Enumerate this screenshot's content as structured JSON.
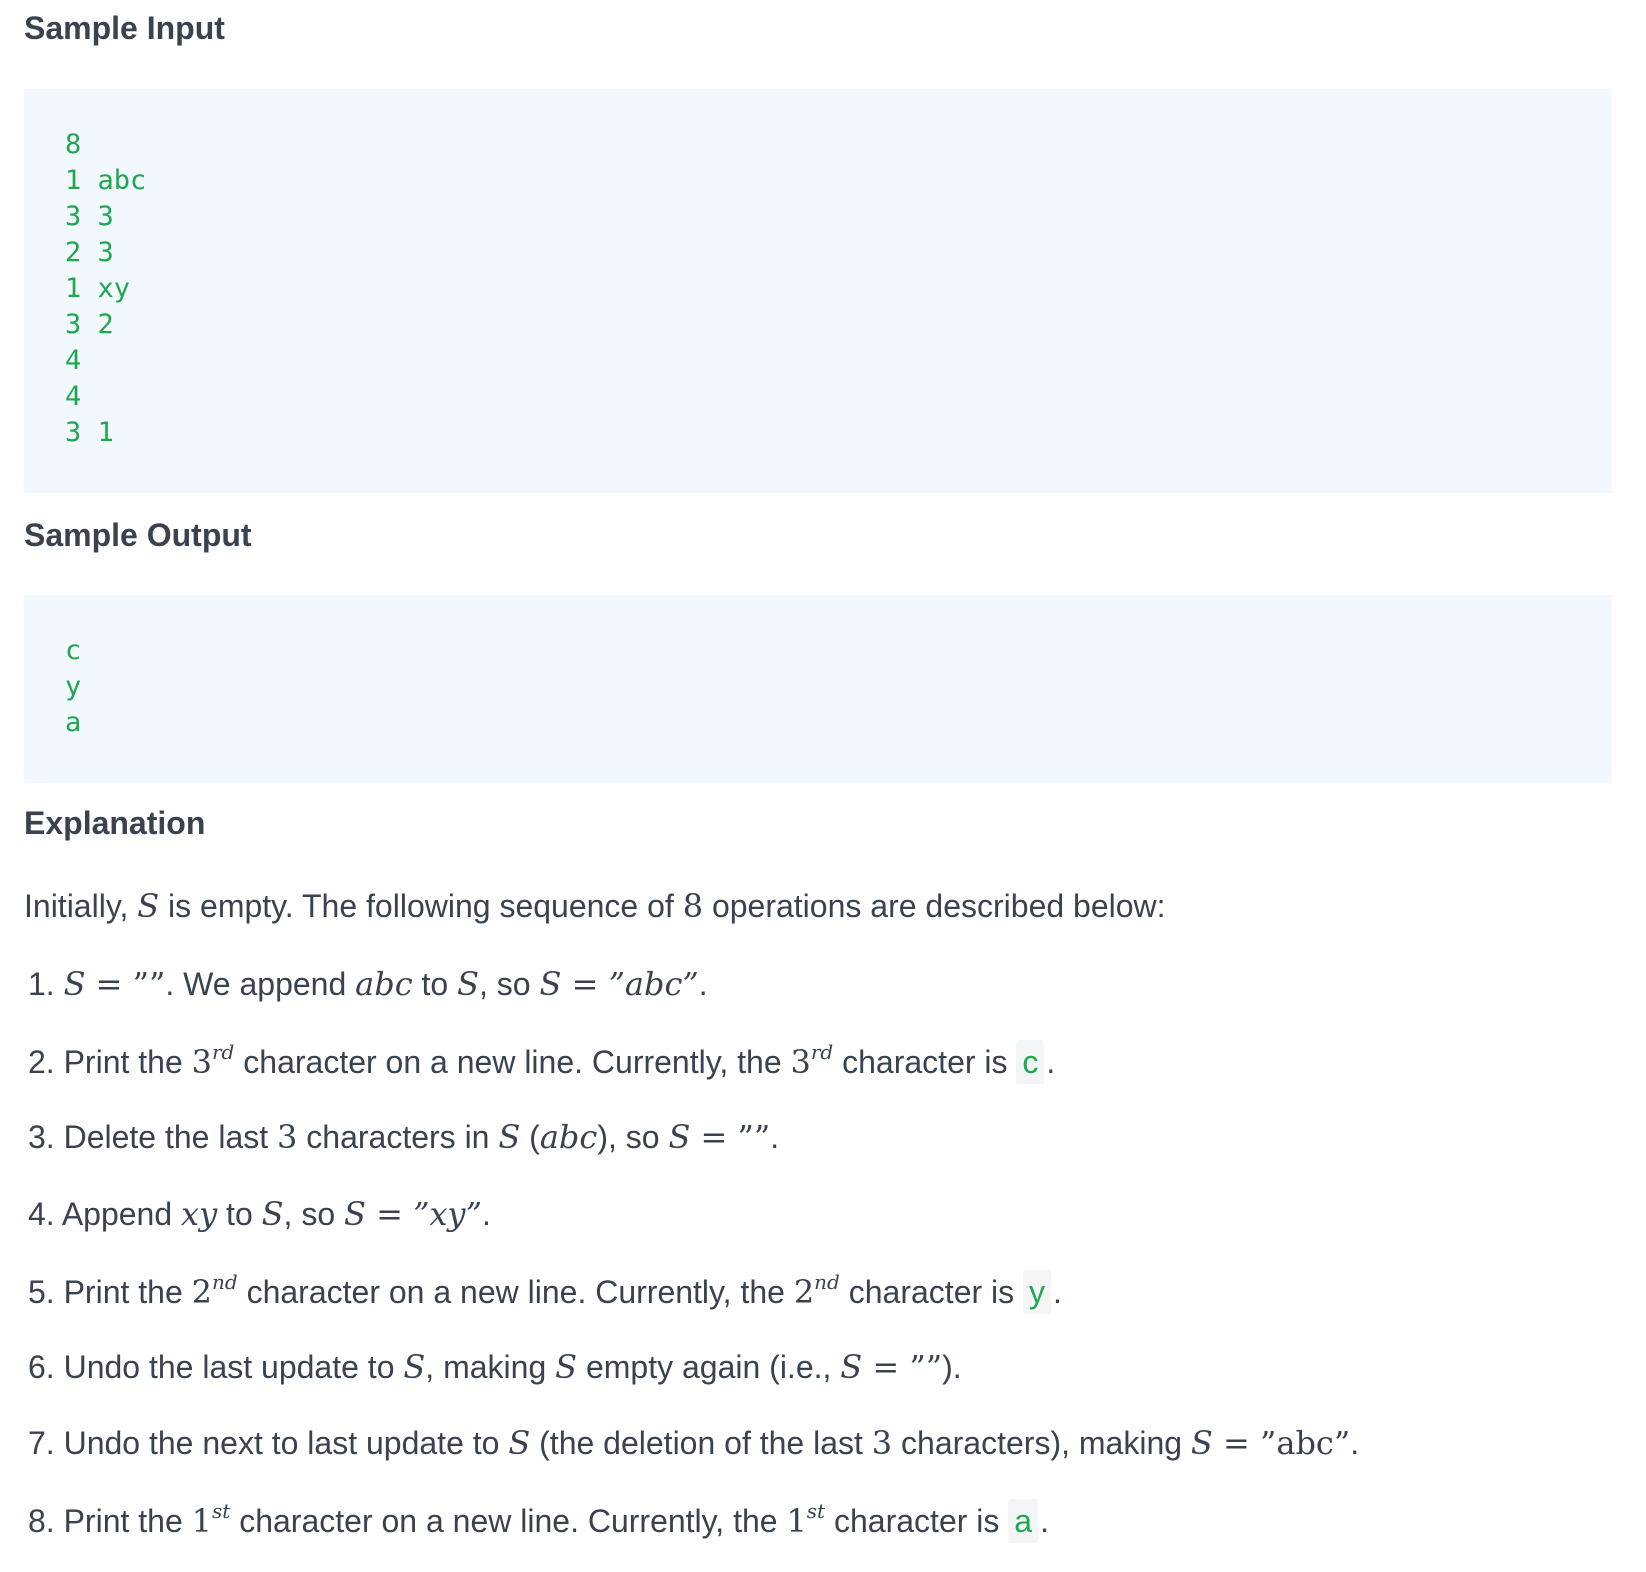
{
  "sample_input": {
    "heading": "Sample Input",
    "lines": [
      "8",
      "1 abc",
      "3 3",
      "2 3",
      "1 xy",
      "3 2",
      "4",
      "4",
      "3 1"
    ]
  },
  "sample_output": {
    "heading": "Sample Output",
    "lines": [
      "c",
      "y",
      "a"
    ]
  },
  "explanation": {
    "heading": "Explanation",
    "intro": {
      "t1": "Initially, ",
      "var_s": "S",
      "t2": " is empty. The following sequence of ",
      "num": "8",
      "t3": " operations are described below:"
    },
    "steps": [
      {
        "n": "1. ",
        "a": "S",
        "b": " = ””",
        "c": ". We append ",
        "d": "abc",
        "e": " to ",
        "f": "S",
        "g": ", so ",
        "h": "S",
        "i": " = ”abc”",
        "j": "."
      },
      {
        "n": "2. ",
        "a": "Print the ",
        "b": "3",
        "c": "rd",
        "d": " character on a new line. Currently, the ",
        "e": "3",
        "f": "rd",
        "g": " character is ",
        "chip": "c",
        "h": "."
      },
      {
        "n": "3. ",
        "a": "Delete the last ",
        "b": "3",
        "c": " characters in ",
        "d": "S",
        "e": " (",
        "f": "abc",
        "g": "), so ",
        "h": "S",
        "i": " = ””",
        "j": "."
      },
      {
        "n": "4. ",
        "a": "Append ",
        "b": "xy",
        "c": " to ",
        "d": "S",
        "e": ", so ",
        "f": "S",
        "g": " = ”xy”",
        "h": "."
      },
      {
        "n": "5. ",
        "a": "Print the ",
        "b": "2",
        "c": "nd",
        "d": " character on a new line. Currently, the ",
        "e": "2",
        "f": "nd",
        "g": " character is ",
        "chip": "y",
        "h": "."
      },
      {
        "n": "6. ",
        "a": "Undo the last update to ",
        "b": "S",
        "c": ", making ",
        "d": "S",
        "e": " empty again (i.e., ",
        "f": "S",
        "g": " = ””",
        "h": ")."
      },
      {
        "n": "7. ",
        "a": "Undo the next to last update to ",
        "b": "S",
        "c": " (the deletion of the last ",
        "d": "3",
        "e": " characters), making ",
        "f": "S",
        "g": " = ”abc”",
        "h": "."
      },
      {
        "n": "8. ",
        "a": "Print the ",
        "b": "1",
        "c": "st",
        "d": " character on a new line. Currently, the ",
        "e": "1",
        "f": "st",
        "g": " character is ",
        "chip": "a",
        "h": "."
      }
    ]
  }
}
